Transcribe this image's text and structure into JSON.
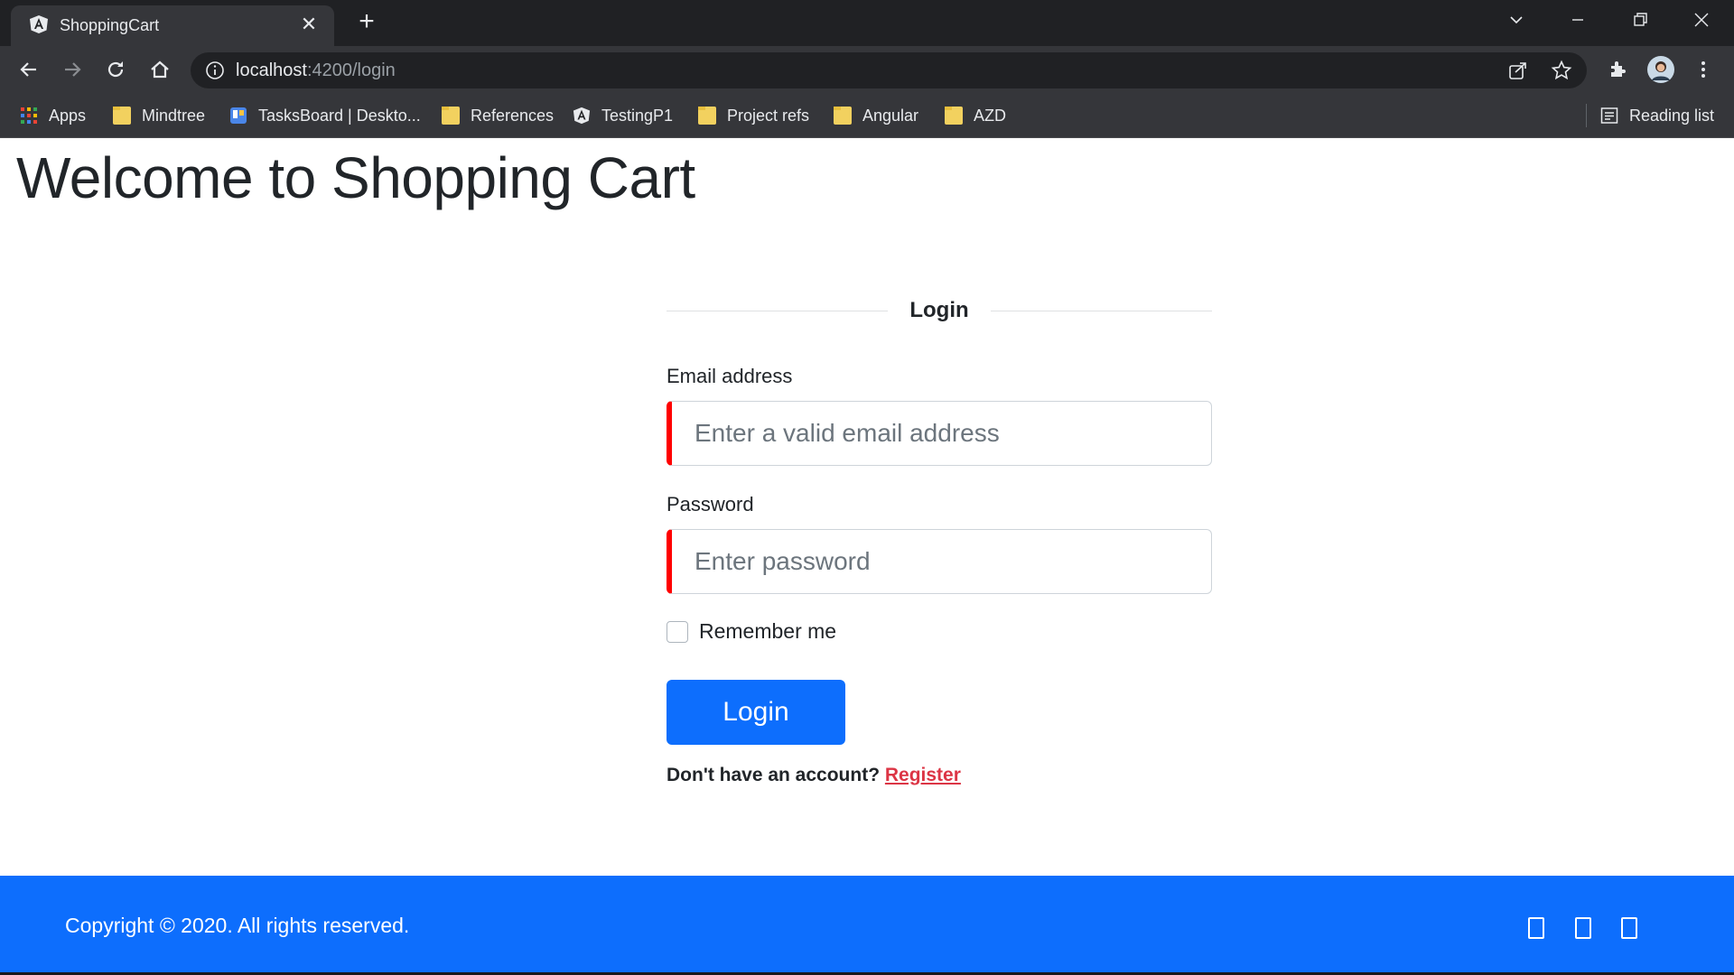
{
  "browser": {
    "tab_title": "ShoppingCart",
    "url_host": "localhost",
    "url_rest": ":4200/login",
    "bookmarks": [
      "Apps",
      "Mindtree",
      "TasksBoard | Deskto...",
      "References",
      "TestingP1",
      "Project refs",
      "Angular",
      "AZD"
    ],
    "reading_list": "Reading list"
  },
  "page": {
    "title": "Welcome to Shopping Cart"
  },
  "login": {
    "heading": "Login",
    "email_label": "Email address",
    "email_placeholder": "Enter a valid email address",
    "password_label": "Password",
    "password_placeholder": "Enter password",
    "remember_label": "Remember me",
    "button_label": "Login",
    "no_account_text": "Don't have an account?",
    "register_link": "Register"
  },
  "footer": {
    "copyright": "Copyright © 2020. All rights reserved."
  },
  "colors": {
    "primary": "#0d6efd",
    "invalid_border": "#ff0000",
    "register_link": "#dc3545"
  }
}
